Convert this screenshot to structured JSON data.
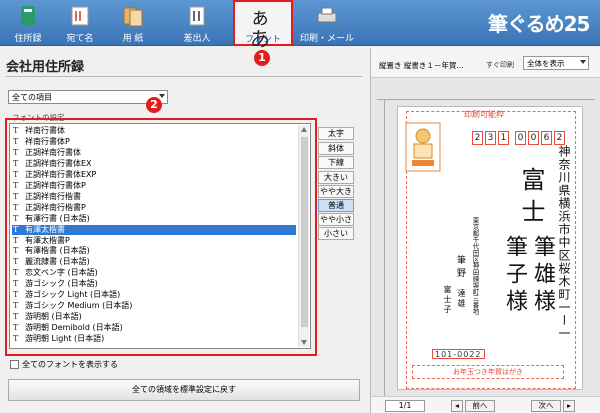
{
  "toolbar": {
    "items": [
      {
        "label": "住所録",
        "icon": "address-book-icon"
      },
      {
        "label": "宛て名",
        "icon": "address-card-icon"
      },
      {
        "label": "用 紙",
        "icon": "paper-icon"
      },
      {
        "label": "差出人",
        "icon": "sender-icon"
      },
      {
        "label": "フォント",
        "icon": "font-icon",
        "glyph": "ぁあ"
      },
      {
        "label": "印刷・メール",
        "icon": "printer-mail-icon"
      }
    ],
    "brand": "筆ぐるめ25"
  },
  "left": {
    "title": "会社用住所録",
    "dropdown": "全ての項目",
    "section_label": "フォントの設定",
    "fonts": [
      "祥南行書体",
      "祥南行書体P",
      "正調祥南行書体",
      "正調祥南行書体EX",
      "正調祥南行書体EXP",
      "正調祥南行書体P",
      "正調祥南行楷書",
      "正調祥南行楷書P",
      "有澤行書 (日本語)",
      "有澤太楷書",
      "有澤太楷書P",
      "有澤楷書 (日本語)",
      "麗流隷書 (日本語)",
      "恋文ペン字 (日本語)",
      "游ゴシック (日本語)",
      "游ゴシック Light (日本語)",
      "游ゴシック Medium (日本語)",
      "游明朝 (日本語)",
      "游明朝 Demibold (日本語)",
      "游明朝 Light (日本語)"
    ],
    "selected_font": "有澤太楷書",
    "style_buttons": [
      "太字",
      "斜体",
      "下線"
    ],
    "size_buttons": [
      "大きい",
      "やや大きい",
      "普通",
      "やや小さい",
      "小さい"
    ],
    "active_size": "普通",
    "show_all_fonts": "全てのフォントを表示する",
    "reset_button": "全ての領域を標準設定に戻す"
  },
  "badges": {
    "one": "1",
    "two": "2"
  },
  "right": {
    "mode": "縦置き 縦書き１－年賀...",
    "print_label": "すぐ印刷",
    "print_select": "全体を表示",
    "card_label": "印刷可能枠",
    "zip_digits": [
      "2",
      "3",
      "1",
      "0",
      "0",
      "6",
      "2"
    ],
    "address_line1": "神奈川県横浜市中区桜木町一ー一",
    "recipient_company": "富士",
    "recipient_names": [
      "筆雄様",
      "筆子様"
    ],
    "sender_address": "東京都千代田区神田練塀町三番地",
    "sender_name1": "筆野",
    "sender_name2": "富士子",
    "sender_name3": "達雄",
    "sender_zip": "101-0022",
    "bottom_label": "お年玉つき年賀はがき",
    "page": "1/1",
    "prev": "前へ",
    "next": "次へ"
  },
  "colors": {
    "accent": "#3b74b6",
    "highlight": "#e31d1d",
    "selection": "#2f78d3"
  }
}
